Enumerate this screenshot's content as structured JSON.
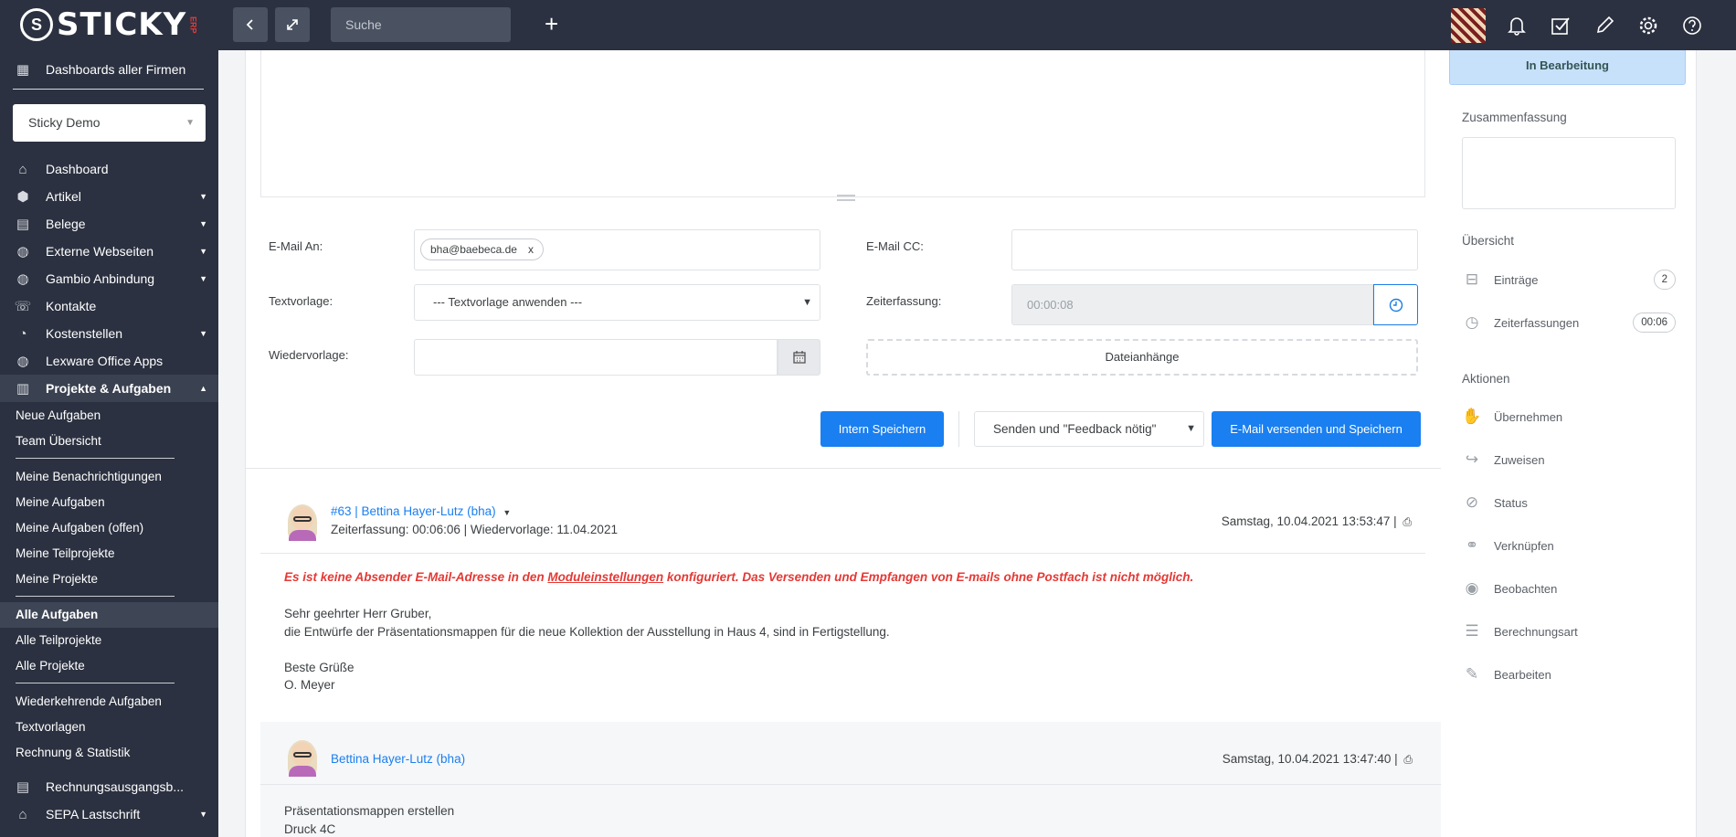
{
  "topbar": {
    "logo_text": "STICKY",
    "logo_sub": "ERP",
    "search_placeholder": "Suche"
  },
  "sidebar": {
    "dashboards_all": "Dashboards aller Firmen",
    "company": "Sticky Demo",
    "nav": [
      {
        "label": "Dashboard",
        "icon": "home-icon"
      },
      {
        "label": "Artikel",
        "icon": "box-icon"
      },
      {
        "label": "Belege",
        "icon": "document-icon"
      },
      {
        "label": "Externe Webseiten",
        "icon": "globe-icon"
      },
      {
        "label": "Gambio Anbindung",
        "icon": "globe-icon"
      },
      {
        "label": "Kontakte",
        "icon": "contacts-icon"
      },
      {
        "label": "Kostenstellen",
        "icon": "pie-chart-icon"
      },
      {
        "label": "Lexware Office Apps",
        "icon": "globe-icon"
      },
      {
        "label": "Projekte & Aufgaben",
        "icon": "projects-icon"
      }
    ],
    "sub_a": [
      "Neue Aufgaben",
      "Team Übersicht"
    ],
    "sub_b": [
      "Meine Benachrichtigungen",
      "Meine Aufgaben",
      "Meine Aufgaben (offen)",
      "Meine Teilprojekte",
      "Meine Projekte"
    ],
    "sub_c": [
      "Alle Aufgaben",
      "Alle Teilprojekte",
      "Alle Projekte"
    ],
    "sub_d": [
      "Wiederkehrende Aufgaben",
      "Textvorlagen",
      "Rechnung & Statistik"
    ],
    "nav_bottom": [
      {
        "label": "Rechnungsausgangsb...",
        "icon": "invoice-icon"
      },
      {
        "label": "SEPA Lastschrift",
        "icon": "bank-icon"
      }
    ]
  },
  "form": {
    "email_to_label": "E-Mail An:",
    "email_to_tag": "bha@baebeca.de",
    "email_to_tag_remove": "x",
    "email_cc_label": "E-Mail CC:",
    "template_label": "Textvorlage:",
    "template_value": "--- Textvorlage anwenden ---",
    "time_label": "Zeiterfassung:",
    "time_value": "00:00:08",
    "resubmit_label": "Wiedervorlage:",
    "attachments_label": "Dateianhänge",
    "save_internal": "Intern Speichern",
    "send_mode": "Senden und \"Feedback nötig\"",
    "send_and_save": "E-Mail versenden und Speichern"
  },
  "entry1": {
    "header_link": "#63 | Bettina Hayer-Lutz (bha)",
    "meta": "Zeiterfassung: 00:06:06 | Wiedervorlage: 11.04.2021",
    "date": "Samstag, 10.04.2021 13:53:47 |",
    "warning_pre": "Es ist keine Absender E-Mail-Adresse in den",
    "warning_link": "Moduleinstellungen",
    "warning_post": "konfiguriert. Das Versenden und Empfangen von E-mails ohne Postfach ist nicht möglich.",
    "line1": "Sehr geehrter Herr Gruber,",
    "line2": "die Entwürfe der Präsentationsmappen für die neue Kollektion der Ausstellung in Haus 4, sind in Fertigstellung.",
    "line3": "Beste Grüße",
    "line4": "O. Meyer"
  },
  "entry2": {
    "header_link": "Bettina Hayer-Lutz (bha)",
    "date": "Samstag, 10.04.2021 13:47:40 |",
    "line1": "Präsentationsmappen erstellen",
    "line2": "Druck 4C"
  },
  "right": {
    "status": "In Bearbeitung",
    "summary_title": "Zusammenfassung",
    "overview_title": "Übersicht",
    "entries_label": "Einträge",
    "entries_count": "2",
    "time_label": "Zeiterfassungen",
    "time_value": "00:06",
    "actions_title": "Aktionen",
    "actions": [
      {
        "label": "Übernehmen",
        "icon": "hand-icon"
      },
      {
        "label": "Zuweisen",
        "icon": "share-icon"
      },
      {
        "label": "Status",
        "icon": "compass-icon"
      },
      {
        "label": "Verknüpfen",
        "icon": "link-icon"
      },
      {
        "label": "Beobachten",
        "icon": "eye-icon"
      },
      {
        "label": "Berechnungsart",
        "icon": "stack-icon"
      },
      {
        "label": "Bearbeiten",
        "icon": "pencil-icon"
      }
    ]
  }
}
